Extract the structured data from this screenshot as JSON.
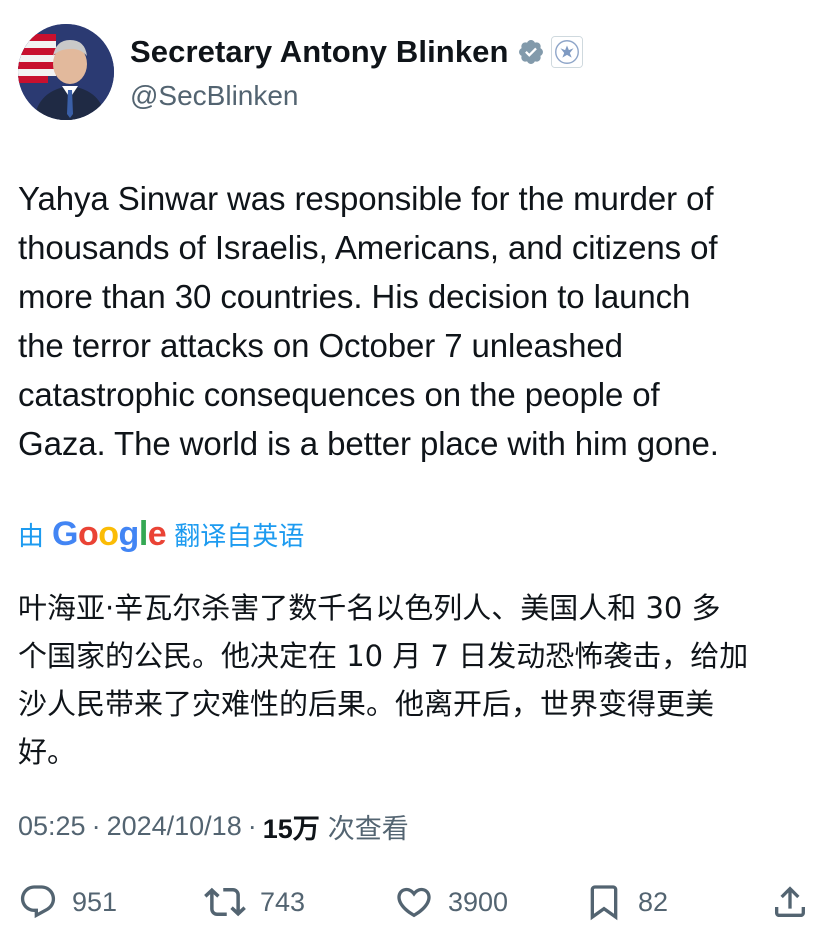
{
  "author": {
    "display_name": "Secretary Antony Blinken",
    "handle": "@SecBlinken",
    "verified_icon": "gray-verified-badge",
    "affiliation_icon": "us-state-department-seal"
  },
  "tweet": {
    "text": "Yahya Sinwar was responsible for the murder of\nthousands of Israelis, Americans, and citizens of\nmore than 30 countries. His decision to launch\nthe terror attacks on October 7 unleashed\ncatastrophic consequences on the people of\nGaza. The world is a better place with him gone."
  },
  "translation": {
    "prefix": "由",
    "provider": "Google",
    "suffix": "翻译自英语",
    "text": "叶海亚·辛瓦尔杀害了数千名以色列人、美国人和 30 多\n个国家的公民。他决定在 10 月 7 日发动恐怖袭击，给加\n沙人民带来了灾难性的后果。他离开后，世界变得更美\n好。"
  },
  "meta": {
    "time": "05:25",
    "separator": "·",
    "date": "2024/10/18",
    "views_count": "15万",
    "views_label": "次查看"
  },
  "actions": {
    "replies": "951",
    "reposts": "743",
    "likes": "3900",
    "bookmarks": "82"
  },
  "colors": {
    "link_blue": "#1d9bf0",
    "secondary_text": "#536471",
    "primary_text": "#0f1419"
  }
}
